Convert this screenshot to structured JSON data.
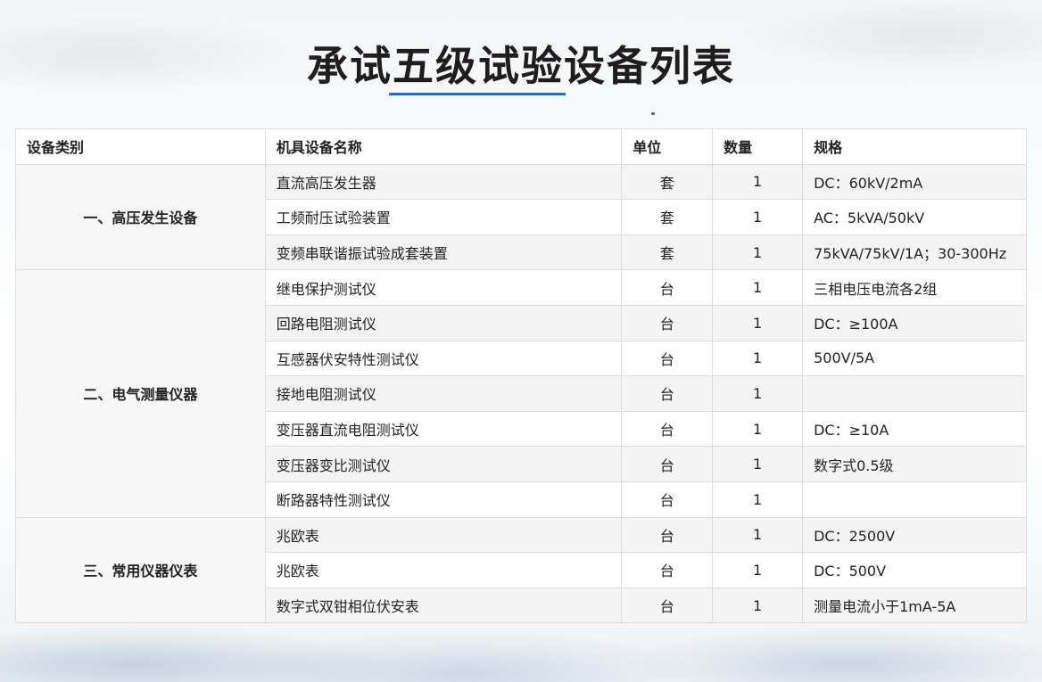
{
  "title": "承试五级试验设备列表",
  "headers": [
    "设备类别",
    "机具设备名称",
    "单位",
    "数量",
    "规格"
  ],
  "groups": [
    {
      "category": "一、高压发生设备",
      "rows": [
        {
          "name": "直流高压发生器",
          "unit": "套",
          "qty": "1",
          "spec": "DC：60kV/2mA"
        },
        {
          "name": "工频耐压试验装置",
          "unit": "套",
          "qty": "1",
          "spec": "AC：5kVA/50kV"
        },
        {
          "name": "变频串联谐振试验成套装置",
          "unit": "套",
          "qty": "1",
          "spec": "75kVA/75kV/1A；30-300Hz"
        }
      ]
    },
    {
      "category": "二、电气测量仪器",
      "rows": [
        {
          "name": "继电保护测试仪",
          "unit": "台",
          "qty": "1",
          "spec": "三相电压电流各2组"
        },
        {
          "name": "回路电阻测试仪",
          "unit": "台",
          "qty": "1",
          "spec": "DC：≥100A"
        },
        {
          "name": "互感器伏安特性测试仪",
          "unit": "台",
          "qty": "1",
          "spec": "500V/5A"
        },
        {
          "name": "接地电阻测试仪",
          "unit": "台",
          "qty": "1",
          "spec": ""
        },
        {
          "name": "变压器直流电阻测试仪",
          "unit": "台",
          "qty": "1",
          "spec": "DC：≥10A"
        },
        {
          "name": "变压器变比测试仪",
          "unit": "台",
          "qty": "1",
          "spec": "数字式0.5级"
        },
        {
          "name": "断路器特性测试仪",
          "unit": "台",
          "qty": "1",
          "spec": ""
        }
      ]
    },
    {
      "category": "三、常用仪器仪表",
      "rows": [
        {
          "name": "兆欧表",
          "unit": "台",
          "qty": "1",
          "spec": "DC：2500V"
        },
        {
          "name": "兆欧表",
          "unit": "台",
          "qty": "1",
          "spec": "DC：500V"
        },
        {
          "name": "数字式双钳相位伏安表",
          "unit": "台",
          "qty": "1",
          "spec": "测量电流小于1mA-5A"
        }
      ]
    }
  ]
}
